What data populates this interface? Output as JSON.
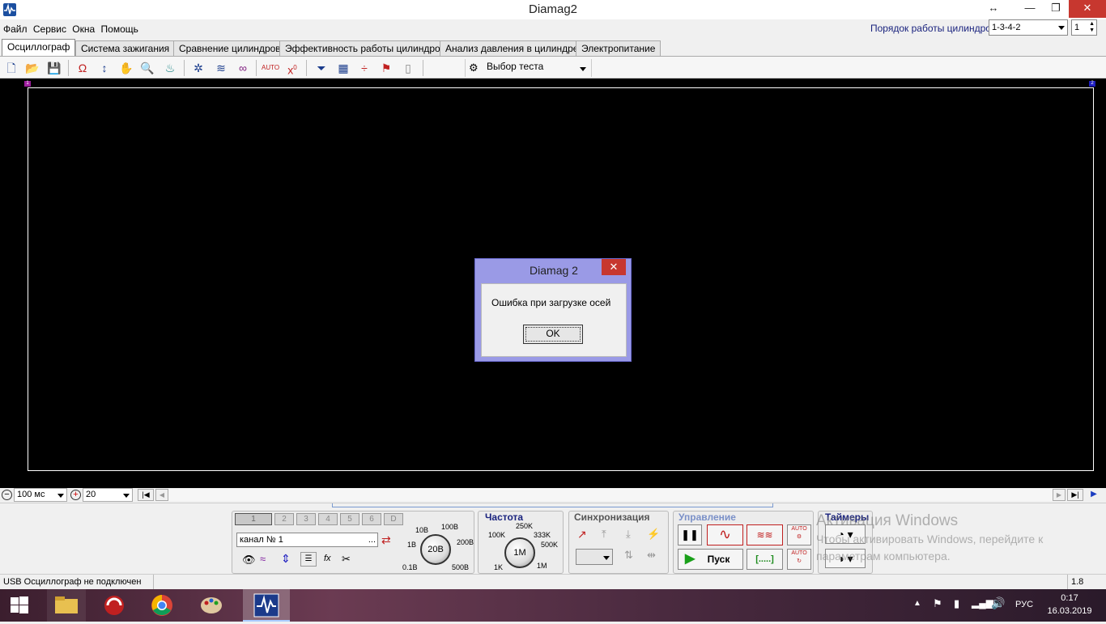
{
  "window": {
    "title": "Diamag2",
    "min": "—",
    "max": "❐",
    "close": "✕",
    "resize": "↔"
  },
  "menu": [
    "Файл",
    "Сервис",
    "Окна",
    "Помощь"
  ],
  "cylinders": {
    "label": "Порядок работы цилиндров",
    "order": "1-3-4-2",
    "number": "1"
  },
  "tabs": [
    "Осциллограф",
    "Система зажигания",
    "Сравнение цилиндров",
    "Эффективность работы цилиндров",
    "Анализ давления в цилиндре",
    "Электропитание"
  ],
  "toolbar": {
    "test_select": "Выбор теста",
    "auto": "AUTO",
    "zero": "0"
  },
  "scope": {
    "marker_left": "1",
    "marker_right": "2"
  },
  "bottom": {
    "timebase": "100 мс",
    "scale": "20"
  },
  "channels": {
    "buttons": [
      "1",
      "2",
      "3",
      "4",
      "5",
      "6",
      "D"
    ],
    "channel_name": "канал № 1",
    "dots": "..."
  },
  "voltage": {
    "value": "20В",
    "labels": [
      "10В",
      "100В",
      "1В",
      "200В",
      "0.1В",
      "500В"
    ]
  },
  "frequency": {
    "title": "Частота",
    "value": "1М",
    "labels": [
      "250K",
      "100K",
      "333K",
      "500K",
      "1K",
      "1M"
    ]
  },
  "sync": {
    "title": "Синхронизация"
  },
  "control": {
    "title": "Управление",
    "start": "Пуск",
    "dots": "[.....]",
    "auto": "AUTO"
  },
  "timers": {
    "title": "Таймеры"
  },
  "status": {
    "usb": "USB Осциллограф не подключен",
    "version": "1.8"
  },
  "dialog": {
    "title": "Diamag 2",
    "message": "Ошибка при загрузке осей",
    "ok": "OK",
    "close": "✕"
  },
  "watermark": {
    "line1": "Активация Windows",
    "line2": "Чтобы активировать Windows, перейдите к",
    "line3": "параметрам компьютера."
  },
  "taskbar": {
    "lang": "РУС",
    "time": "0:17",
    "date": "16.03.2019"
  }
}
